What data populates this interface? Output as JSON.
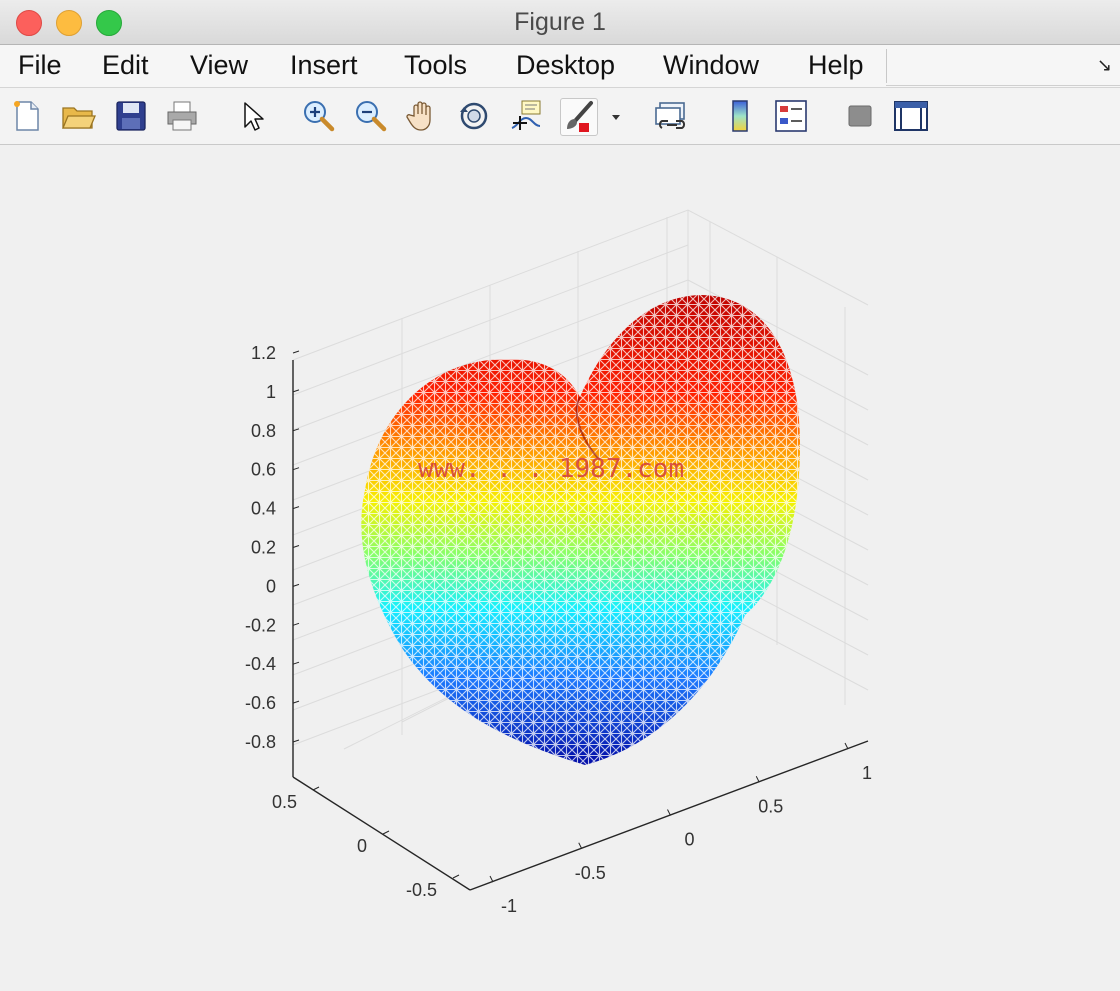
{
  "window": {
    "title": "Figure 1"
  },
  "menu": [
    "File",
    "Edit",
    "View",
    "Insert",
    "Tools",
    "Desktop",
    "Window",
    "Help"
  ],
  "toolbar": {
    "icons": [
      "new-figure-icon",
      "open-file-icon",
      "save-icon",
      "print-icon",
      "pointer-icon",
      "zoom-in-icon",
      "zoom-out-icon",
      "pan-hand-icon",
      "rotate-3d-icon",
      "data-cursor-icon",
      "brush-icon",
      "brush-dropdown-icon",
      "link-plot-icon",
      "colorbar-icon",
      "legend-icon",
      "hide-plot-tools-icon",
      "show-plot-tools-icon"
    ]
  },
  "watermark": "www.  .  .   1987.com",
  "chart_data": {
    "type": "surface-mesh",
    "title": "",
    "xlabel": "",
    "ylabel": "",
    "zlabel": "",
    "x_ticks": [
      "-1",
      "-0.5",
      "0",
      "0.5",
      "1"
    ],
    "y_ticks": [
      "-0.5",
      "0",
      "0.5"
    ],
    "z_ticks": [
      "-0.8",
      "-0.6",
      "-0.4",
      "-0.2",
      "0",
      "0.2",
      "0.4",
      "0.6",
      "0.8",
      "1",
      "1.2"
    ],
    "xlim": [
      -1.1,
      1.1
    ],
    "ylim": [
      -0.6,
      0.6
    ],
    "zlim": [
      -0.95,
      1.25
    ],
    "grid": true,
    "colormap": "jet",
    "colors": {
      "high": "#cc0000",
      "mid": "#e8f000",
      "low": "#0000b4"
    }
  }
}
